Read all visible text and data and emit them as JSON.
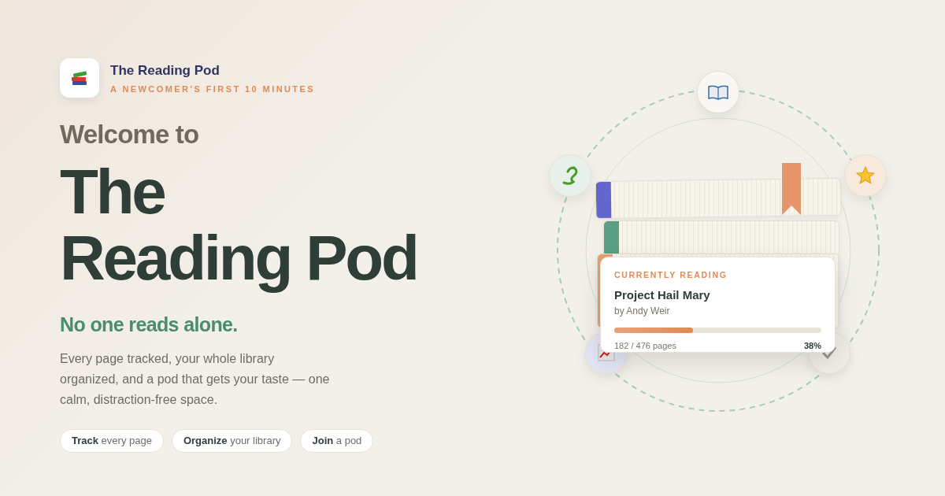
{
  "brand": {
    "name": "The Reading Pod",
    "tagline": "A NEWCOMER'S FIRST 10 MINUTES"
  },
  "hero": {
    "eyebrow": "Welcome to",
    "title_lines": [
      "The",
      "Reading Pod"
    ],
    "subtitle": "No one reads alone.",
    "body": "Every page tracked, your whole library organized, and a pod that gets your taste — one calm, distraction-free space."
  },
  "chips": [
    "**Track** every page",
    "**Organize** your library",
    "**Join** a pod"
  ],
  "books": [
    {
      "color": "#6366cc"
    },
    {
      "color": "#5a9e85"
    },
    {
      "color": "#e8a070"
    }
  ],
  "card": {
    "label": "CURRENTLY READING",
    "title": "Project Hail Mary",
    "author": "by Andy Weir",
    "level": 0.38,
    "pages": "182 / 476 pages",
    "percent": "38%"
  }
}
